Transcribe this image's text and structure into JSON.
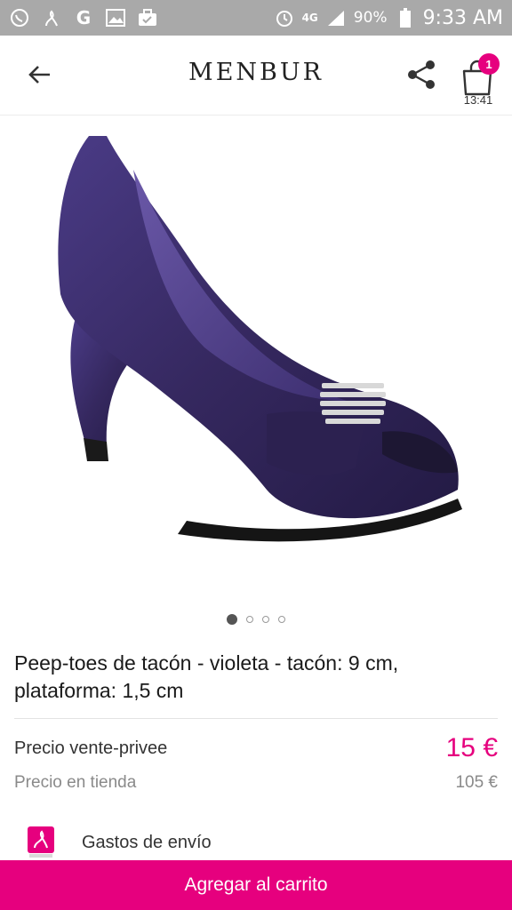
{
  "status_bar": {
    "left_icons": [
      "whatsapp-icon",
      "vente-privee-icon",
      "google-icon",
      "gallery-icon",
      "briefcase-icon"
    ],
    "network": "4G",
    "battery": "90%",
    "time": "9:33 AM"
  },
  "header": {
    "brand": "MENBUR",
    "cart_count": "1",
    "cart_timer": "13:41"
  },
  "product": {
    "image_icon": "violet-peep-toe-shoe",
    "image_count": 4,
    "active_image": 1,
    "title": "Peep-toes de tacón - violeta - tacón: 9 cm, plataforma: 1,5 cm"
  },
  "prices": {
    "sale_label": "Precio vente-privee",
    "sale_value": "15 €",
    "store_label": "Precio en tienda",
    "store_value": "105 €"
  },
  "shipping": {
    "label": "Gastos de envío"
  },
  "cta": {
    "label": "Agregar al carrito"
  },
  "colors": {
    "accent": "#e6007e",
    "statusbar": "#a9a9a9",
    "shoe": "#3b2e6e"
  }
}
